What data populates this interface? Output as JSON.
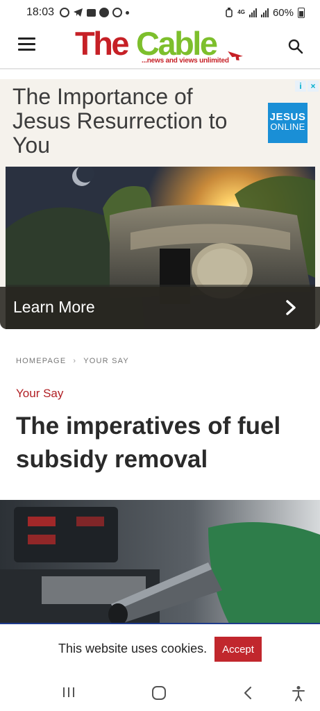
{
  "status_bar": {
    "time": "18:03",
    "network": "4G",
    "battery": "60%"
  },
  "header": {
    "logo_the": "The",
    "logo_cable": "Cable",
    "logo_tagline": "...news and views unlimited",
    "colors": {
      "logo_red": "#c62026",
      "logo_green": "#7dbf2c"
    }
  },
  "ad": {
    "title": "The Importance of Jesus Resurrection to You",
    "brand_line1": "JESUS",
    "brand_line2": "ONLINE",
    "cta_label": "Learn More",
    "badge_info": "i",
    "badge_close": "×"
  },
  "article": {
    "breadcrumb": [
      "HOMEPAGE",
      "YOUR SAY"
    ],
    "category": "Your Say",
    "headline": "The imperatives of fuel subsidy removal",
    "accent_color": "#b11f24"
  },
  "cookie_bar": {
    "message": "This website uses cookies.",
    "accept_label": "Accept"
  }
}
